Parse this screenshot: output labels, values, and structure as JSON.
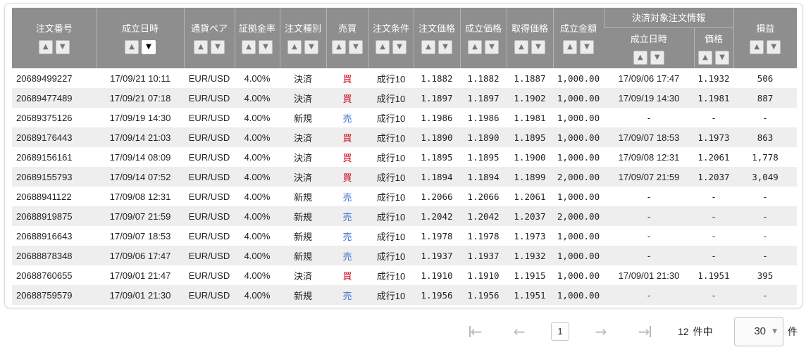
{
  "table": {
    "settlement_group_label": "決済対象注文情報",
    "columns": {
      "order_no": "注文番号",
      "exec_time": "成立日時",
      "pair": "通貨ペア",
      "margin_rate": "証拠金率",
      "order_type": "注文種別",
      "side": "売買",
      "condition": "注文条件",
      "order_price": "注文価格",
      "exec_price": "成立価格",
      "acq_price": "取得価格",
      "exec_amount": "成立金額",
      "settle_time": "成立日時",
      "settle_price": "価格",
      "pnl": "損益"
    },
    "sort_up_glyph": "▲",
    "sort_down_glyph": "▼",
    "active_sort": "exec_time_desc",
    "rows": [
      {
        "order_no": "20689499227",
        "exec_time": "17/09/21 10:11",
        "pair": "EUR/USD",
        "margin_rate": "4.00%",
        "order_type": "決済",
        "side": "買",
        "side_kind": "buy",
        "condition": "成行10",
        "order_price": "1.1882",
        "exec_price": "1.1882",
        "acq_price": "1.1887",
        "exec_amount": "1,000.00",
        "settle_time": "17/09/06 17:47",
        "settle_price": "1.1932",
        "pnl": "506"
      },
      {
        "order_no": "20689477489",
        "exec_time": "17/09/21 07:18",
        "pair": "EUR/USD",
        "margin_rate": "4.00%",
        "order_type": "決済",
        "side": "買",
        "side_kind": "buy",
        "condition": "成行10",
        "order_price": "1.1897",
        "exec_price": "1.1897",
        "acq_price": "1.1902",
        "exec_amount": "1,000.00",
        "settle_time": "17/09/19 14:30",
        "settle_price": "1.1981",
        "pnl": "887"
      },
      {
        "order_no": "20689375126",
        "exec_time": "17/09/19 14:30",
        "pair": "EUR/USD",
        "margin_rate": "4.00%",
        "order_type": "新規",
        "side": "売",
        "side_kind": "sell",
        "condition": "成行10",
        "order_price": "1.1986",
        "exec_price": "1.1986",
        "acq_price": "1.1981",
        "exec_amount": "1,000.00",
        "settle_time": "-",
        "settle_price": "-",
        "pnl": "-"
      },
      {
        "order_no": "20689176443",
        "exec_time": "17/09/14 21:03",
        "pair": "EUR/USD",
        "margin_rate": "4.00%",
        "order_type": "決済",
        "side": "買",
        "side_kind": "buy",
        "condition": "成行10",
        "order_price": "1.1890",
        "exec_price": "1.1890",
        "acq_price": "1.1895",
        "exec_amount": "1,000.00",
        "settle_time": "17/09/07 18:53",
        "settle_price": "1.1973",
        "pnl": "863"
      },
      {
        "order_no": "20689156161",
        "exec_time": "17/09/14 08:09",
        "pair": "EUR/USD",
        "margin_rate": "4.00%",
        "order_type": "決済",
        "side": "買",
        "side_kind": "buy",
        "condition": "成行10",
        "order_price": "1.1895",
        "exec_price": "1.1895",
        "acq_price": "1.1900",
        "exec_amount": "1,000.00",
        "settle_time": "17/09/08 12:31",
        "settle_price": "1.2061",
        "pnl": "1,778"
      },
      {
        "order_no": "20689155793",
        "exec_time": "17/09/14 07:52",
        "pair": "EUR/USD",
        "margin_rate": "4.00%",
        "order_type": "決済",
        "side": "買",
        "side_kind": "buy",
        "condition": "成行10",
        "order_price": "1.1894",
        "exec_price": "1.1894",
        "acq_price": "1.1899",
        "exec_amount": "2,000.00",
        "settle_time": "17/09/07 21:59",
        "settle_price": "1.2037",
        "pnl": "3,049"
      },
      {
        "order_no": "20688941122",
        "exec_time": "17/09/08 12:31",
        "pair": "EUR/USD",
        "margin_rate": "4.00%",
        "order_type": "新規",
        "side": "売",
        "side_kind": "sell",
        "condition": "成行10",
        "order_price": "1.2066",
        "exec_price": "1.2066",
        "acq_price": "1.2061",
        "exec_amount": "1,000.00",
        "settle_time": "-",
        "settle_price": "-",
        "pnl": "-"
      },
      {
        "order_no": "20688919875",
        "exec_time": "17/09/07 21:59",
        "pair": "EUR/USD",
        "margin_rate": "4.00%",
        "order_type": "新規",
        "side": "売",
        "side_kind": "sell",
        "condition": "成行10",
        "order_price": "1.2042",
        "exec_price": "1.2042",
        "acq_price": "1.2037",
        "exec_amount": "2,000.00",
        "settle_time": "-",
        "settle_price": "-",
        "pnl": "-"
      },
      {
        "order_no": "20688916643",
        "exec_time": "17/09/07 18:53",
        "pair": "EUR/USD",
        "margin_rate": "4.00%",
        "order_type": "新規",
        "side": "売",
        "side_kind": "sell",
        "condition": "成行10",
        "order_price": "1.1978",
        "exec_price": "1.1978",
        "acq_price": "1.1973",
        "exec_amount": "1,000.00",
        "settle_time": "-",
        "settle_price": "-",
        "pnl": "-"
      },
      {
        "order_no": "20688878348",
        "exec_time": "17/09/06 17:47",
        "pair": "EUR/USD",
        "margin_rate": "4.00%",
        "order_type": "新規",
        "side": "売",
        "side_kind": "sell",
        "condition": "成行10",
        "order_price": "1.1937",
        "exec_price": "1.1937",
        "acq_price": "1.1932",
        "exec_amount": "1,000.00",
        "settle_time": "-",
        "settle_price": "-",
        "pnl": "-"
      },
      {
        "order_no": "20688760655",
        "exec_time": "17/09/01 21:47",
        "pair": "EUR/USD",
        "margin_rate": "4.00%",
        "order_type": "決済",
        "side": "買",
        "side_kind": "buy",
        "condition": "成行10",
        "order_price": "1.1910",
        "exec_price": "1.1910",
        "acq_price": "1.1915",
        "exec_amount": "1,000.00",
        "settle_time": "17/09/01 21:30",
        "settle_price": "1.1951",
        "pnl": "395"
      },
      {
        "order_no": "20688759579",
        "exec_time": "17/09/01 21:30",
        "pair": "EUR/USD",
        "margin_rate": "4.00%",
        "order_type": "新規",
        "side": "売",
        "side_kind": "sell",
        "condition": "成行10",
        "order_price": "1.1956",
        "exec_price": "1.1956",
        "acq_price": "1.1951",
        "exec_amount": "1,000.00",
        "settle_time": "-",
        "settle_price": "-",
        "pnl": "-"
      }
    ]
  },
  "colors": {
    "header_bg": "#8e8e8e",
    "stripe_bg": "#eeeeee",
    "buy": "#d0021b",
    "sell": "#3a6fcf"
  },
  "pagination": {
    "first_icon": "first-page-icon",
    "prev_icon": "prev-page-icon",
    "next_icon": "next-page-icon",
    "last_icon": "last-page-icon",
    "current_page": "1",
    "total_count": "12",
    "count_suffix": "件中",
    "per_page": "30",
    "per_page_suffix": "件"
  }
}
